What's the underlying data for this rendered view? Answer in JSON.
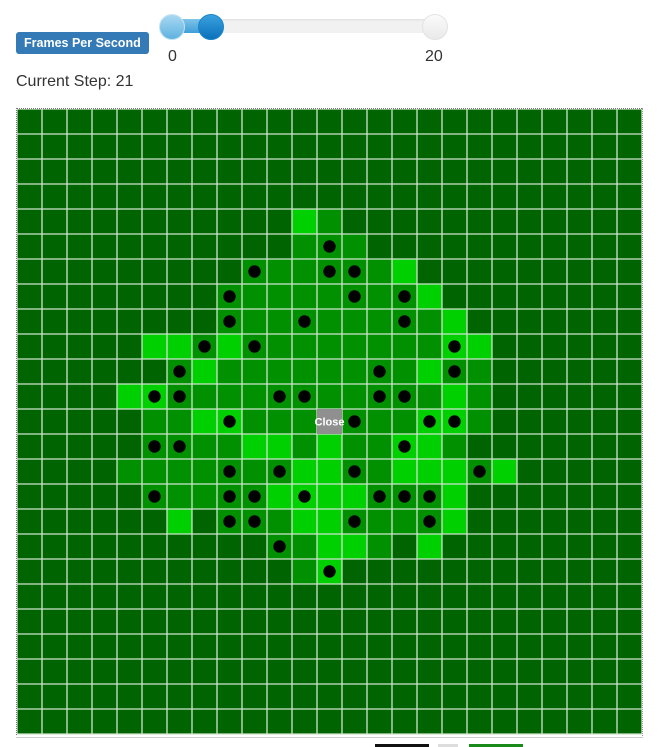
{
  "controls": {
    "fps_label": "Frames Per Second",
    "slider_min": "0",
    "slider_max": "20",
    "slider_value_fraction": 0.15
  },
  "status": {
    "current_step": "Current Step: 21"
  },
  "board": {
    "rows": 25,
    "cols": 25,
    "close_label": "Close",
    "close_cell": [
      12,
      12
    ],
    "colors": {
      "base": "#006400",
      "mid": "#009000",
      "bright": "#00d000",
      "grid_line": "#cfe3cf",
      "dot": "#000000",
      "close_bg": "#8f8f8f"
    },
    "mid_cells": [
      [
        4,
        11
      ],
      [
        4,
        12
      ],
      [
        5,
        11
      ],
      [
        5,
        12
      ],
      [
        5,
        13
      ],
      [
        6,
        9
      ],
      [
        6,
        10
      ],
      [
        6,
        11
      ],
      [
        6,
        12
      ],
      [
        6,
        13
      ],
      [
        6,
        14
      ],
      [
        6,
        15
      ],
      [
        7,
        8
      ],
      [
        7,
        9
      ],
      [
        7,
        10
      ],
      [
        7,
        11
      ],
      [
        7,
        12
      ],
      [
        7,
        13
      ],
      [
        7,
        14
      ],
      [
        7,
        15
      ],
      [
        7,
        16
      ],
      [
        8,
        8
      ],
      [
        8,
        9
      ],
      [
        8,
        10
      ],
      [
        8,
        11
      ],
      [
        8,
        12
      ],
      [
        8,
        13
      ],
      [
        8,
        14
      ],
      [
        8,
        15
      ],
      [
        8,
        16
      ],
      [
        8,
        17
      ],
      [
        9,
        6
      ],
      [
        9,
        7
      ],
      [
        9,
        8
      ],
      [
        9,
        9
      ],
      [
        9,
        10
      ],
      [
        9,
        11
      ],
      [
        9,
        12
      ],
      [
        9,
        13
      ],
      [
        9,
        14
      ],
      [
        9,
        15
      ],
      [
        9,
        16
      ],
      [
        9,
        17
      ],
      [
        9,
        18
      ],
      [
        10,
        6
      ],
      [
        10,
        7
      ],
      [
        10,
        8
      ],
      [
        10,
        9
      ],
      [
        10,
        10
      ],
      [
        10,
        11
      ],
      [
        10,
        12
      ],
      [
        10,
        13
      ],
      [
        10,
        14
      ],
      [
        10,
        15
      ],
      [
        10,
        16
      ],
      [
        10,
        17
      ],
      [
        10,
        18
      ],
      [
        11,
        5
      ],
      [
        11,
        6
      ],
      [
        11,
        7
      ],
      [
        11,
        8
      ],
      [
        11,
        9
      ],
      [
        11,
        10
      ],
      [
        11,
        11
      ],
      [
        11,
        12
      ],
      [
        11,
        13
      ],
      [
        11,
        14
      ],
      [
        11,
        15
      ],
      [
        11,
        16
      ],
      [
        11,
        17
      ],
      [
        11,
        18
      ],
      [
        12,
        5
      ],
      [
        12,
        6
      ],
      [
        12,
        7
      ],
      [
        12,
        8
      ],
      [
        12,
        9
      ],
      [
        12,
        10
      ],
      [
        12,
        11
      ],
      [
        12,
        13
      ],
      [
        12,
        14
      ],
      [
        12,
        15
      ],
      [
        12,
        16
      ],
      [
        12,
        17
      ],
      [
        12,
        18
      ],
      [
        13,
        5
      ],
      [
        13,
        6
      ],
      [
        13,
        7
      ],
      [
        13,
        8
      ],
      [
        13,
        9
      ],
      [
        13,
        10
      ],
      [
        13,
        11
      ],
      [
        13,
        12
      ],
      [
        13,
        13
      ],
      [
        13,
        14
      ],
      [
        13,
        15
      ],
      [
        13,
        16
      ],
      [
        13,
        17
      ],
      [
        14,
        4
      ],
      [
        14,
        5
      ],
      [
        14,
        6
      ],
      [
        14,
        7
      ],
      [
        14,
        8
      ],
      [
        14,
        9
      ],
      [
        14,
        10
      ],
      [
        14,
        11
      ],
      [
        14,
        12
      ],
      [
        14,
        13
      ],
      [
        14,
        14
      ],
      [
        14,
        15
      ],
      [
        14,
        16
      ],
      [
        14,
        17
      ],
      [
        14,
        18
      ],
      [
        14,
        19
      ],
      [
        15,
        5
      ],
      [
        15,
        6
      ],
      [
        15,
        7
      ],
      [
        15,
        8
      ],
      [
        15,
        9
      ],
      [
        15,
        10
      ],
      [
        15,
        11
      ],
      [
        15,
        12
      ],
      [
        15,
        13
      ],
      [
        15,
        14
      ],
      [
        15,
        15
      ],
      [
        15,
        16
      ],
      [
        15,
        17
      ],
      [
        16,
        6
      ],
      [
        16,
        8
      ],
      [
        16,
        9
      ],
      [
        16,
        10
      ],
      [
        16,
        11
      ],
      [
        16,
        12
      ],
      [
        16,
        13
      ],
      [
        16,
        14
      ],
      [
        16,
        15
      ],
      [
        16,
        16
      ],
      [
        16,
        17
      ],
      [
        17,
        10
      ],
      [
        17,
        11
      ],
      [
        17,
        12
      ],
      [
        17,
        13
      ],
      [
        17,
        14
      ],
      [
        17,
        16
      ],
      [
        18,
        11
      ],
      [
        18,
        12
      ]
    ],
    "bright_cells": [
      [
        4,
        11
      ],
      [
        6,
        15
      ],
      [
        7,
        16
      ],
      [
        8,
        17
      ],
      [
        9,
        5
      ],
      [
        9,
        6
      ],
      [
        9,
        8
      ],
      [
        9,
        17
      ],
      [
        9,
        18
      ],
      [
        10,
        7
      ],
      [
        10,
        16
      ],
      [
        11,
        4
      ],
      [
        11,
        5
      ],
      [
        11,
        17
      ],
      [
        12,
        7
      ],
      [
        12,
        8
      ],
      [
        12,
        16
      ],
      [
        12,
        17
      ],
      [
        13,
        9
      ],
      [
        13,
        10
      ],
      [
        13,
        12
      ],
      [
        13,
        15
      ],
      [
        13,
        16
      ],
      [
        14,
        11
      ],
      [
        14,
        12
      ],
      [
        14,
        15
      ],
      [
        14,
        16
      ],
      [
        14,
        17
      ],
      [
        14,
        19
      ],
      [
        15,
        10
      ],
      [
        15,
        11
      ],
      [
        15,
        12
      ],
      [
        15,
        13
      ],
      [
        15,
        17
      ],
      [
        16,
        6
      ],
      [
        16,
        11
      ],
      [
        16,
        12
      ],
      [
        16,
        17
      ],
      [
        17,
        12
      ],
      [
        17,
        13
      ],
      [
        17,
        16
      ],
      [
        18,
        12
      ]
    ],
    "dots": [
      [
        5,
        12
      ],
      [
        6,
        9
      ],
      [
        6,
        12
      ],
      [
        6,
        13
      ],
      [
        7,
        8
      ],
      [
        7,
        13
      ],
      [
        7,
        15
      ],
      [
        8,
        8
      ],
      [
        8,
        11
      ],
      [
        8,
        15
      ],
      [
        9,
        7
      ],
      [
        9,
        9
      ],
      [
        9,
        17
      ],
      [
        10,
        6
      ],
      [
        10,
        14
      ],
      [
        10,
        17
      ],
      [
        11,
        5
      ],
      [
        11,
        6
      ],
      [
        11,
        10
      ],
      [
        11,
        11
      ],
      [
        11,
        14
      ],
      [
        11,
        15
      ],
      [
        12,
        8
      ],
      [
        12,
        13
      ],
      [
        12,
        16
      ],
      [
        12,
        17
      ],
      [
        13,
        5
      ],
      [
        13,
        6
      ],
      [
        13,
        15
      ],
      [
        14,
        8
      ],
      [
        14,
        10
      ],
      [
        14,
        13
      ],
      [
        14,
        18
      ],
      [
        15,
        5
      ],
      [
        15,
        8
      ],
      [
        15,
        9
      ],
      [
        15,
        11
      ],
      [
        15,
        14
      ],
      [
        15,
        15
      ],
      [
        15,
        16
      ],
      [
        16,
        8
      ],
      [
        16,
        9
      ],
      [
        16,
        13
      ],
      [
        16,
        16
      ],
      [
        17,
        10
      ],
      [
        18,
        12
      ]
    ]
  }
}
